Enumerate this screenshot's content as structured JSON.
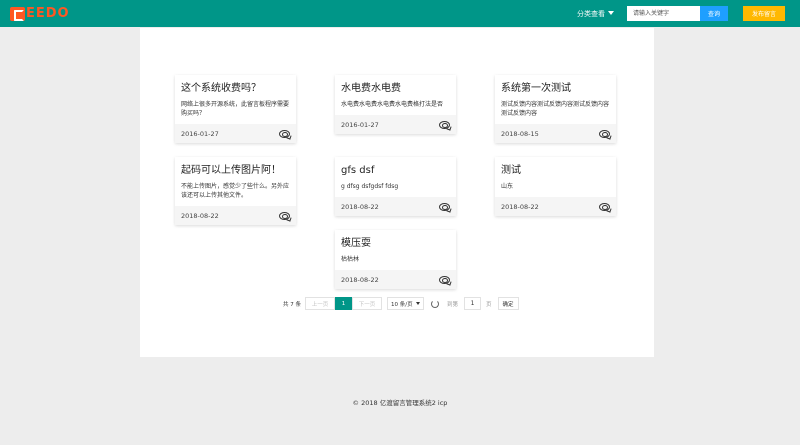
{
  "header": {
    "logo_text": "EEDO",
    "category_label": "分类查看",
    "search_placeholder": "请输入关键字",
    "search_button": "查询",
    "post_button": "发布留言"
  },
  "cards": [
    {
      "title": "这个系统收费吗？",
      "body": "网络上很多开源系统，此留言板程序需要购买吗？",
      "date": "2016-01-27"
    },
    {
      "title": "水电费水电费",
      "body": "水电费水电费水电费水电费格打法是否",
      "date": "2016-01-27"
    },
    {
      "title": "系统第一次测试",
      "body": "测试反馈内容测试反馈内容测试反馈内容测试反馈内容",
      "date": "2018-08-15"
    },
    {
      "title": "起码可以上传图片阿！",
      "body": "不能上传图片，感觉少了些什么。另外应该还可以上传其他文件。",
      "date": "2018-08-22"
    },
    {
      "title": "gfs dsf",
      "body": "g dfsg dsfgdsf fdsg",
      "date": "2018-08-22"
    },
    {
      "title": "测试",
      "body": "山东",
      "date": "2018-08-22"
    },
    {
      "title": "模压耍",
      "body": "枯枯林",
      "date": "2018-08-22"
    }
  ],
  "pagination": {
    "total_text": "共 7 条",
    "prev": "上一页",
    "current": "1",
    "next": "下一页",
    "page_size": "10 条/页",
    "goto_label": "到第",
    "page_input": "1",
    "unit": "页",
    "confirm": "确定"
  },
  "footer": {
    "text": "© 2018 亿渡留言管理系统2  icp"
  },
  "colors": {
    "primary": "#009688",
    "search_button": "#1e9fff",
    "post_button": "#ffb800",
    "logo": "#ff5722"
  }
}
